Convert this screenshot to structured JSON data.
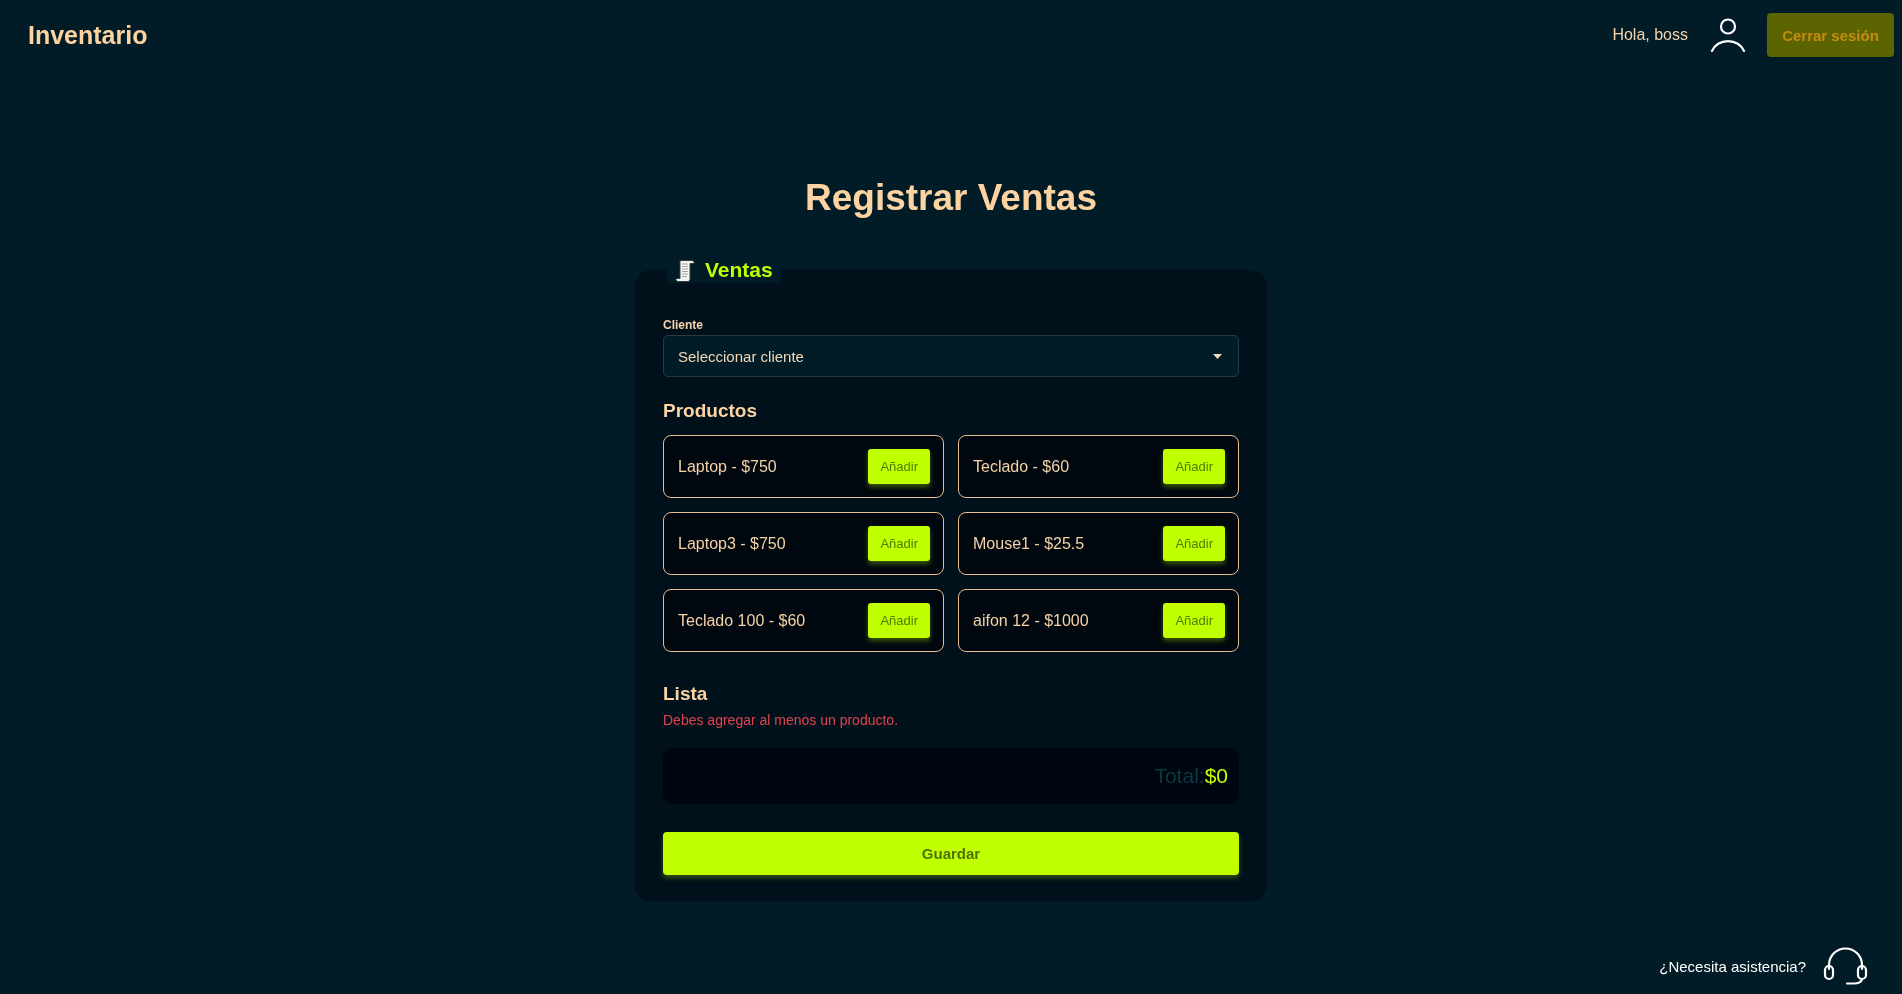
{
  "header": {
    "brand": "Inventario",
    "greeting": "Hola, boss",
    "logout_button": "Cerrar sesión"
  },
  "page_title": "Registrar Ventas",
  "sales_form": {
    "legend": "Ventas",
    "client_field": {
      "label": "Cliente",
      "placeholder": "Seleccionar cliente"
    },
    "products_heading": "Productos",
    "products": [
      {
        "label": "Laptop - $750",
        "button": "Añadir"
      },
      {
        "label": "Teclado - $60",
        "button": "Añadir"
      },
      {
        "label": "Laptop3 - $750",
        "button": "Añadir"
      },
      {
        "label": "Mouse1 - $25.5",
        "button": "Añadir"
      },
      {
        "label": "Teclado 100 - $60",
        "button": "Añadir"
      },
      {
        "label": "aifon 12 - $1000",
        "button": "Añadir"
      }
    ],
    "list_heading": "Lista",
    "error_message": "Debes agregar al menos un producto.",
    "total": {
      "label": "Total:",
      "value": "$0"
    },
    "save_button": "Guardar"
  },
  "help": {
    "text": "¿Necesita asistencia?"
  }
}
